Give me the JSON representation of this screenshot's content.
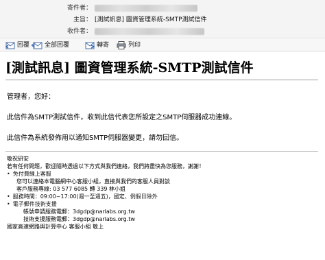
{
  "header": {
    "from_label": "寄件者：",
    "subject_label": "主旨：",
    "subject_value": "[測試訊息] 圖資管理系統-SMTP測試信件",
    "to_label": "收件者："
  },
  "toolbar": {
    "reply": "回覆",
    "reply_all": "全部回覆",
    "forward": "轉寄",
    "print": "列印"
  },
  "body": {
    "title": "[測試訊息] 圖資管理系統-SMTP測試信件",
    "greeting": "管理者，您好：",
    "line1": "此信件為SMTP測試信件，收到此信代表您所設定之SMTP伺服器成功連線。",
    "line2": "此信件為系統發佈用以通知SMTP伺服器變更，請勿回信。"
  },
  "signature": {
    "line1": "敬祝研安",
    "line2": "若有任何問題，歡迎隨時透過以下方式與我們連絡，我們將盡快為您服務，謝謝！",
    "b1": "免付費線上客服",
    "b1a": "您可以連絡本電腦網中心客服小組，直接與我們的客服人員對談",
    "b1b": "客戶服務專線: 03 577 6085 轉 339 林小姐",
    "b2": "服務時間：09:00~17:00(週一至週五)，國定、例假日除外",
    "b3": "電子郵件技術支援",
    "b3a": "帳號申請服務電郵：3dgdp@narlabs.org.tw",
    "b3b": "技術支援服務電郵：3dgdp@narlabs.org.tw",
    "footer": "國家高速網路與計算中心 客服小組 敬上"
  }
}
